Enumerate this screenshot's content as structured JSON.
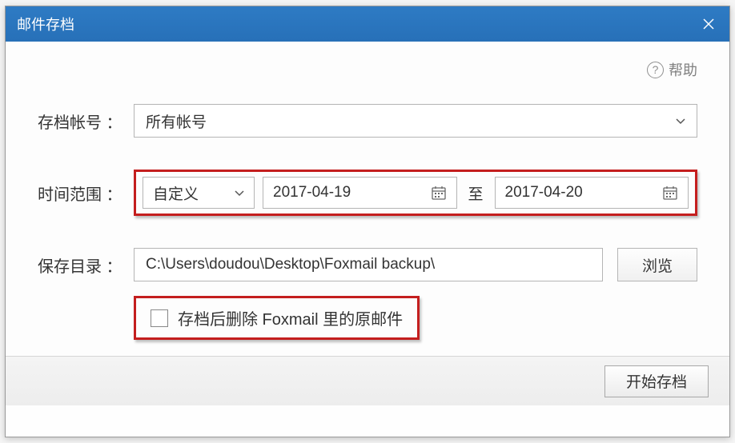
{
  "title": "邮件存档",
  "help_label": "帮助",
  "form": {
    "account_label": "存档帐号 ：",
    "account_value": "所有帐号",
    "time_label": "时间范围 ：",
    "time_mode": "自定义",
    "date_from": "2017-04-19",
    "date_to_label": "至",
    "date_to": "2017-04-20",
    "save_label": "保存目录 ：",
    "save_path": "C:\\Users\\doudou\\Desktop\\Foxmail backup\\",
    "browse_label": "浏览",
    "delete_label": "存档后删除 Foxmail 里的原邮件"
  },
  "footer": {
    "start_label": "开始存档"
  }
}
